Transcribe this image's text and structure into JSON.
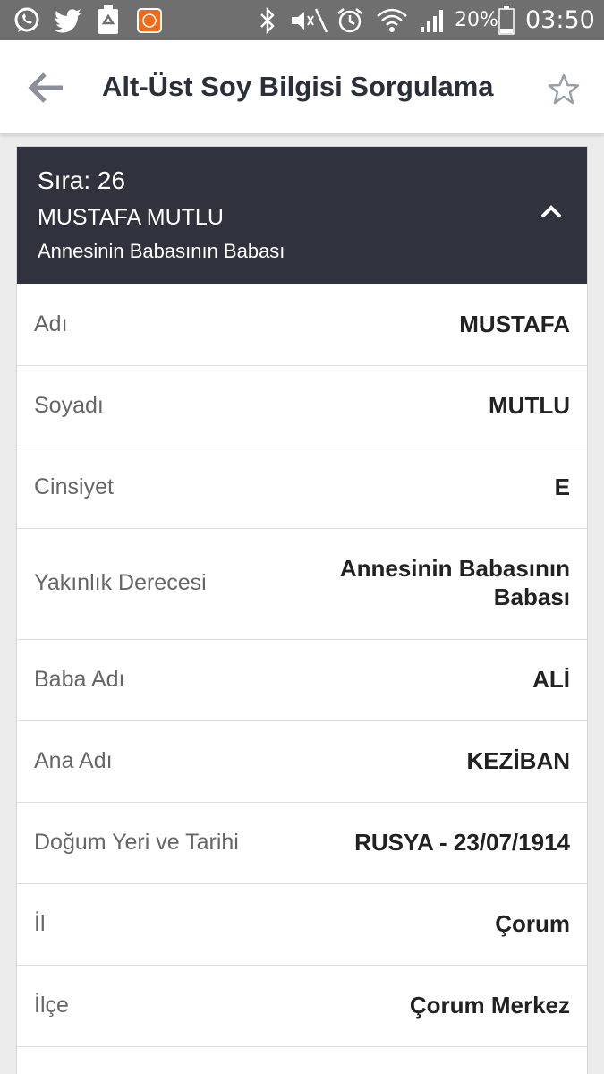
{
  "status_bar": {
    "battery": "20%",
    "time": "03:50",
    "icons": [
      "whatsapp-icon",
      "twitter-icon",
      "recycle-icon",
      "mi-icon",
      "bluetooth-icon",
      "mute-icon",
      "alarm-icon",
      "wifi-icon",
      "signal-icon",
      "battery-icon"
    ]
  },
  "app_bar": {
    "title": "Alt-Üst Soy Bilgisi Sorgulama",
    "back_icon": "arrow-left-icon",
    "favorite_icon": "star-outline-icon"
  },
  "record": {
    "sira": "Sıra: 26",
    "name": "MUSTAFA MUTLU",
    "relation": "Annesinin Babasının Babası",
    "toggle_icon": "chevron-up-icon"
  },
  "rows": [
    {
      "label": "Adı",
      "value": "MUSTAFA"
    },
    {
      "label": "Soyadı",
      "value": "MUTLU"
    },
    {
      "label": "Cinsiyet",
      "value": "E"
    },
    {
      "label": "Yakınlık Derecesi",
      "value_line1": "Annesinin Babasının",
      "value_line2": "Babası"
    },
    {
      "label": "Baba Adı",
      "value": "ALİ"
    },
    {
      "label": "Ana Adı",
      "value": "KEZİBAN"
    },
    {
      "label": "Doğum Yeri ve Tarihi",
      "value": "RUSYA - 23/07/1914"
    },
    {
      "label": "İl",
      "value": "Çorum"
    },
    {
      "label": "İlçe",
      "value": "Çorum Merkez"
    }
  ],
  "colors": {
    "status_bar": "#6f6f6f",
    "header": "#30333d",
    "background": "#ececec",
    "accent_mi": "#f06a1a"
  }
}
